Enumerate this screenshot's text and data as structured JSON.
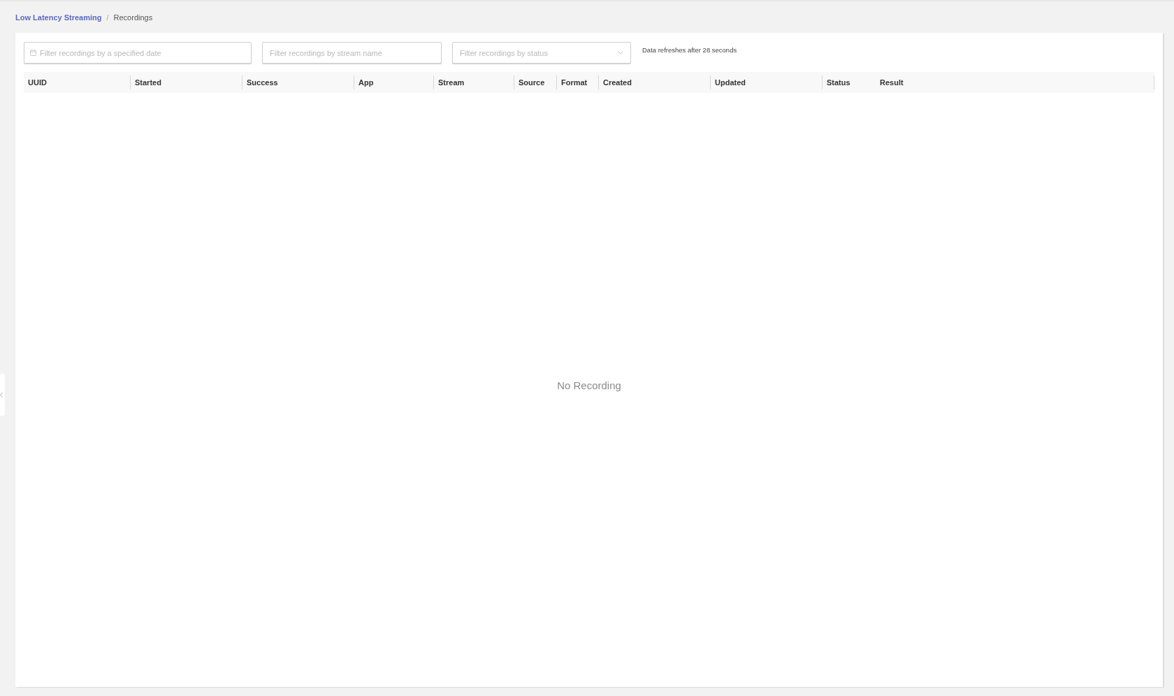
{
  "breadcrumb": {
    "separator": "/",
    "items": [
      {
        "label": "Low Latency Streaming",
        "kind": "link"
      },
      {
        "label": "Recordings",
        "kind": "current"
      }
    ]
  },
  "filters": [
    {
      "kind": "date",
      "placeholder": "Filter recordings by a specified date"
    },
    {
      "kind": "text",
      "placeholder": "Filter recordings by stream name"
    },
    {
      "kind": "select",
      "placeholder": "Filter recordings by status"
    }
  ],
  "refresh_note": "Data refreshes after 28 seconds",
  "table": {
    "columns": [
      "UUID",
      "Started",
      "Success",
      "App",
      "Stream",
      "Source",
      "Format",
      "Created",
      "Updated",
      "Status",
      "Result"
    ],
    "empty_message": "No Recording"
  }
}
